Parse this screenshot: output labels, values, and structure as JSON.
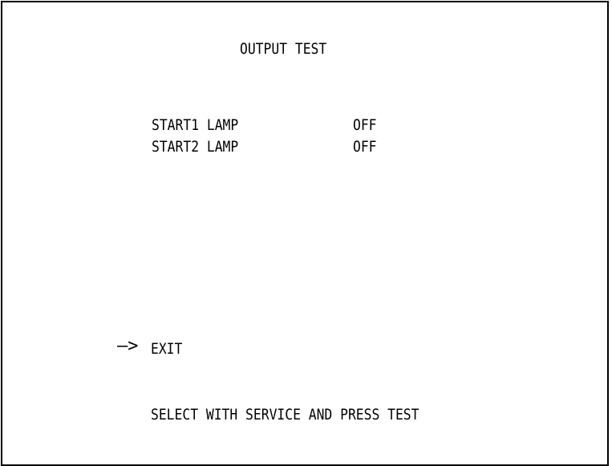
{
  "screen": {
    "title": "OUTPUT TEST",
    "items": [
      {
        "label": "START1 LAMP",
        "value": "OFF"
      },
      {
        "label": "START2 LAMP",
        "value": "OFF"
      }
    ],
    "cursor": "—>",
    "exit_label": "EXIT",
    "instruction": "SELECT WITH SERVICE AND PRESS TEST"
  }
}
